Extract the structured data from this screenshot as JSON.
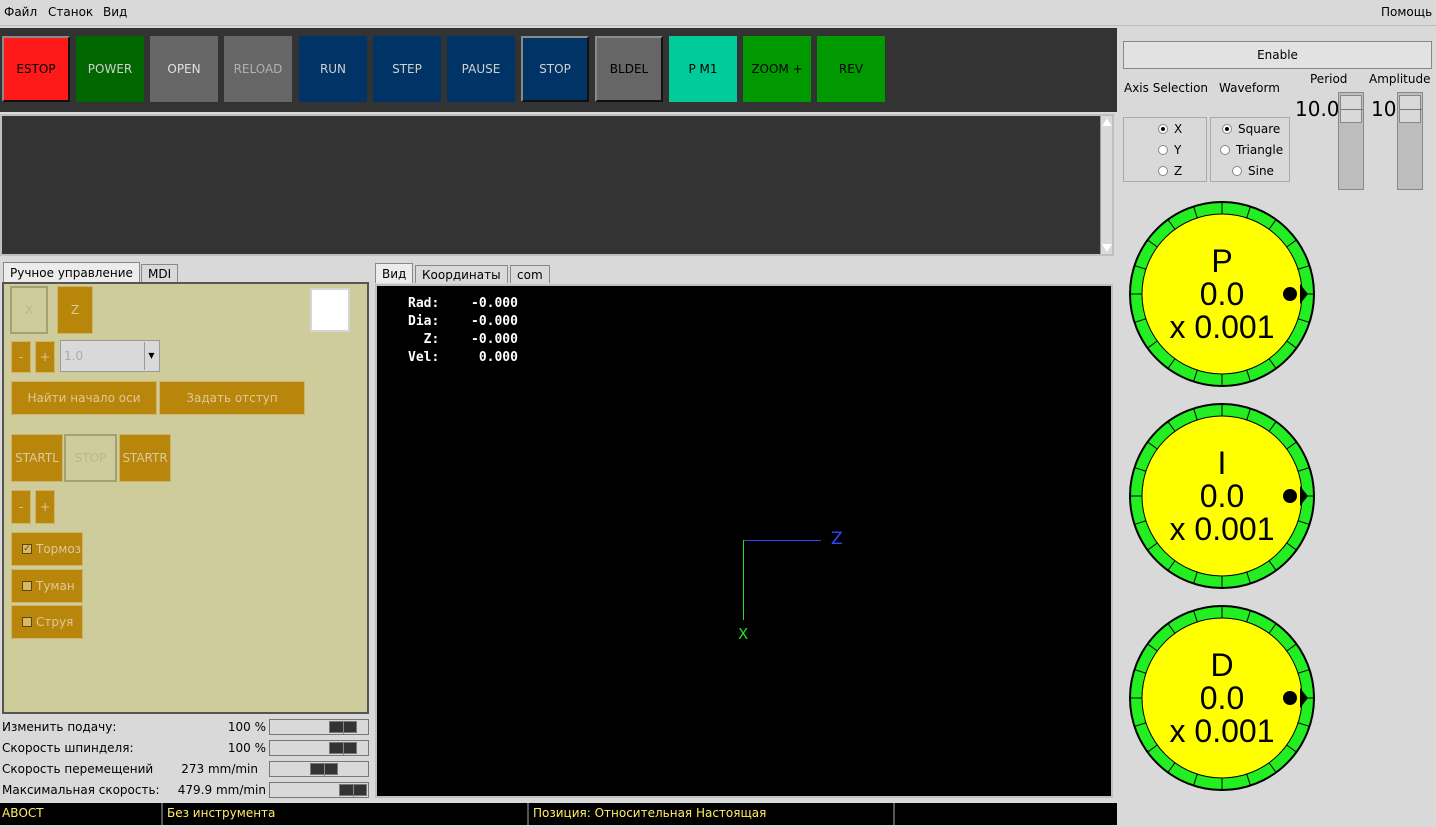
{
  "menubar": {
    "items": [
      "Файл",
      "Станок",
      "Вид"
    ],
    "help": "Помощь"
  },
  "toolbar": {
    "buttons": [
      {
        "label": "ESTOP",
        "color": "#ff1a1a",
        "text_color": "#000000"
      },
      {
        "label": "POWER",
        "color": "#006600",
        "text_color": "#d0d0d0"
      },
      {
        "label": "OPEN",
        "color": "#666666",
        "text_color": "#e0e0e0"
      },
      {
        "label": "RELOAD",
        "color": "#666666",
        "text_color": "#b0b0b0"
      },
      {
        "label": "RUN",
        "color": "#003366",
        "text_color": "#d0d0d0"
      },
      {
        "label": "STEP",
        "color": "#003366",
        "text_color": "#d0d0d0"
      },
      {
        "label": "PAUSE",
        "color": "#003366",
        "text_color": "#d0d0d0"
      },
      {
        "label": "STOP",
        "color": "#003366",
        "text_color": "#d0d0d0"
      },
      {
        "label": "BLDEL",
        "color": "#666666",
        "text_color": "#000000"
      },
      {
        "label": "P M1",
        "color": "#00cc99",
        "text_color": "#000000"
      },
      {
        "label": "ZOOM +",
        "color": "#009900",
        "text_color": "#000000"
      },
      {
        "label": "REV",
        "color": "#009900",
        "text_color": "#000000"
      }
    ]
  },
  "left_tabs": {
    "manual": "Ручное управление",
    "mdi": "MDI"
  },
  "manual": {
    "axis_x": "X",
    "axis_z": "Z",
    "minus": "-",
    "plus": "+",
    "increment": "1.0",
    "home": "Найти начало оси",
    "touch_off": "Задать отступ",
    "start_left": "STARTL",
    "stop": "STOP",
    "start_right": "STARTR",
    "brake": "Тормоз",
    "mist": "Туман",
    "flood": "Струя"
  },
  "overrides": [
    {
      "label": "Изменить подачу:",
      "value": "100 %",
      "fraction": 0.85
    },
    {
      "label": "Скорость шпинделя:",
      "value": "100 %",
      "fraction": 0.85
    },
    {
      "label": "Скорость перемещений",
      "value": "273 mm/min",
      "fraction": 0.57
    },
    {
      "label": "Максимальная скорость:",
      "value": "479.9 mm/min",
      "fraction": 1.0
    }
  ],
  "view_tabs": [
    "Вид",
    "Координаты",
    "com"
  ],
  "dro": [
    {
      "label": "Rad:",
      "value": "-0.000"
    },
    {
      "label": "Dia:",
      "value": "-0.000"
    },
    {
      "label": "  Z:",
      "value": "-0.000"
    },
    {
      "label": "Vel:",
      "value": " 0.000"
    }
  ],
  "axes": {
    "z": "Z",
    "x": "X"
  },
  "status": {
    "state": "АВОСТ",
    "tool": "Без инструмента",
    "position": "Позиция: Относительная Настоящая"
  },
  "right": {
    "enable": "Enable",
    "axis_selection": "Axis Selection",
    "waveform": "Waveform",
    "period": "Period",
    "amplitude": "Amplitude",
    "period_value": "10.0",
    "amplitude_value": "10",
    "axis_options": [
      "X",
      "Y",
      "Z"
    ],
    "axis_selected": "X",
    "wave_options": [
      "Square",
      "Triangle",
      "Sine"
    ],
    "wave_selected": "Square",
    "dials": [
      {
        "name": "P",
        "value": "0.0",
        "scale": "x 0.001"
      },
      {
        "name": "I",
        "value": "0.0",
        "scale": "x 0.001"
      },
      {
        "name": "D",
        "value": "0.0",
        "scale": "x 0.001"
      }
    ]
  }
}
